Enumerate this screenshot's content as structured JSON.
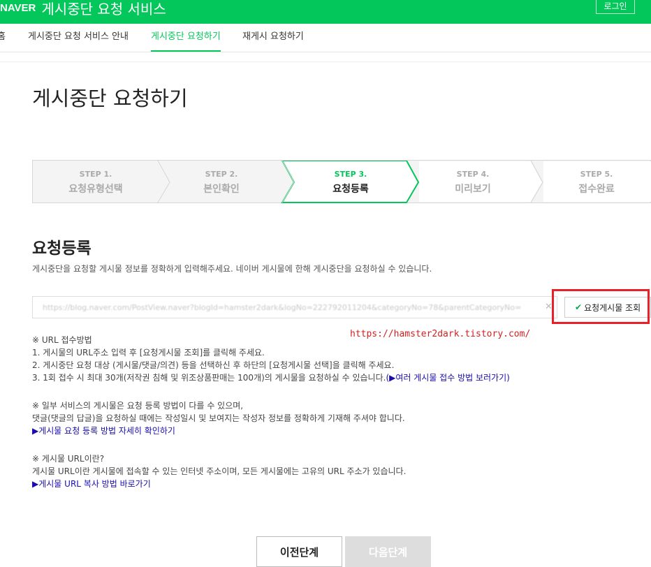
{
  "header": {
    "logo": "NAVER",
    "service_title": "게시중단 요청 서비스",
    "login_label": "로그인"
  },
  "nav": {
    "home": "홈",
    "guide": "게시중단 요청 서비스 안내",
    "request": "게시중단 요청하기",
    "repost": "재게시 요청하기"
  },
  "page_title": "게시중단 요청하기",
  "steps": [
    {
      "num": "STEP 1.",
      "name": "요청유형선택",
      "active": false
    },
    {
      "num": "STEP 2.",
      "name": "본인확인",
      "active": false
    },
    {
      "num": "STEP 3.",
      "name": "요청등록",
      "active": true
    },
    {
      "num": "STEP 4.",
      "name": "미리보기",
      "active": false
    },
    {
      "num": "STEP 5.",
      "name": "접수완료",
      "active": false
    }
  ],
  "section": {
    "title": "요청등록",
    "description": "게시중단을 요청할 게시물 정보를 정확하게 입력해주세요. 네이버 게시물에 한해 게시중단을 요청하실 수 있습니다.",
    "url_value": "https://blog.naver.com/PostView.naver?blogId=hamster2dark&logNo=222792011204&categoryNo=78&parentCategoryNo=",
    "lookup_button": "요청게시물 조회",
    "watermark": "https://hamster2dark.tistory.com/"
  },
  "notes": {
    "url_heading": "※ URL 접수방법",
    "url_1": "1. 게시물의 URL주소 입력 후 [요청게시물 조회]를 클릭해 주세요.",
    "url_2": "2. 게시중단 요청 대상 (게시물/댓글/의견) 등을 선택하신 후 하단의 [요청게시물 선택]을 클릭해 주세요.",
    "url_3": "3. 1회 접수 시 최대 30개(저작권 침해 및 위조상품판매는 100개)의 게시물을 요청하실 수 있습니다.",
    "url_3_link": "(▶여러 게시물 접수 방법 보러가기)",
    "service_heading": "※ 일부 서비스의 게시물은 요청 등록 방법이 다를 수 있으며,",
    "service_text": "댓글(댓글의 답글)을 요청하실 때에는 작성일시 및 보여지는 작성자 정보를 정확하게 기재해 주셔야 합니다.",
    "service_link": "▶게시물 요청 등록 방법 자세히 확인하기",
    "what_heading": "※ 게시물 URL이란?",
    "what_text": "게시물 URL이란 게시물에 접속할 수 있는 인터넷 주소이며, 모든 게시물에는 고유의 URL 주소가 있습니다.",
    "what_link": "▶게시물 URL 복사 방법 바로가기"
  },
  "buttons": {
    "prev": "이전단계",
    "next": "다음단계"
  },
  "colors": {
    "brand": "#03c75a",
    "highlight_box": "#e8202a",
    "link": "#1a0dab"
  }
}
